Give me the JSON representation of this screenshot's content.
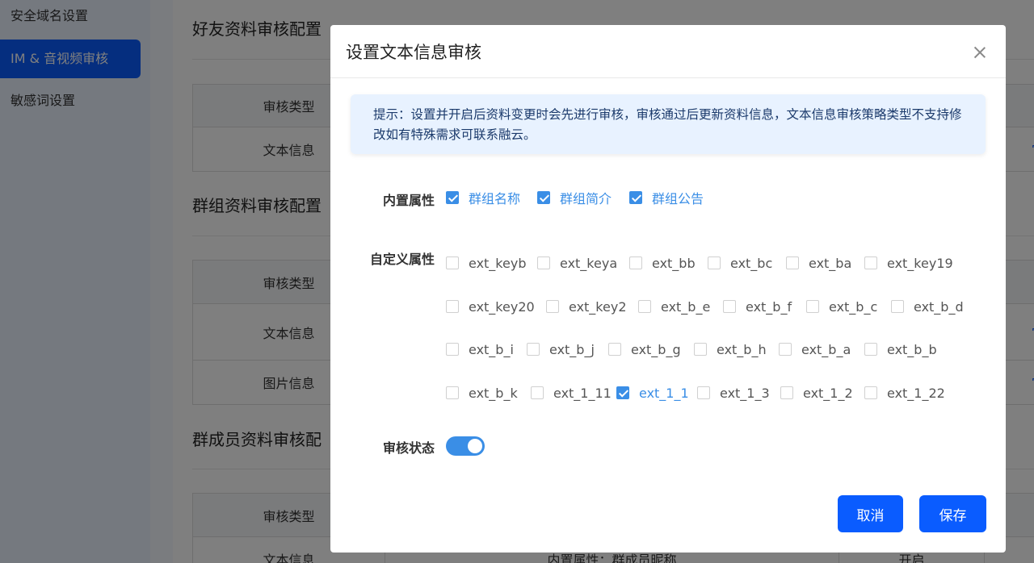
{
  "sidebar": {
    "items": [
      {
        "label": "安全域名设置"
      },
      {
        "label": "IM & 音视频审核"
      },
      {
        "label": "敏感词设置"
      }
    ]
  },
  "main": {
    "sections": [
      {
        "title": "好友资料审核配置",
        "rows": [
          [
            "审核类型"
          ],
          [
            "文本信息",
            "",
            "",
            "官"
          ]
        ]
      },
      {
        "title": "群组资料审核配置",
        "rows": [
          [
            "审核类型"
          ],
          [
            "文本信息",
            "",
            "",
            "官"
          ],
          [
            "图片信息",
            "",
            "",
            "官"
          ]
        ]
      },
      {
        "title": "群成员资料审核配",
        "rows": [
          [
            "审核类型"
          ],
          [
            "文本信息",
            "内置属性：群成员昵称",
            "开启",
            ""
          ]
        ]
      }
    ]
  },
  "modal": {
    "title": "设置文本信息审核",
    "tip": "提示：设置并开启后资料变更时会先进行审核，审核通过后更新资料信息，文本信息审核策略类型不支持修改如有特殊需求可联系融云。",
    "builtin_label": "内置属性",
    "builtin_options": [
      {
        "label": "群组名称",
        "checked": true
      },
      {
        "label": "群组简介",
        "checked": true
      },
      {
        "label": "群组公告",
        "checked": true
      }
    ],
    "custom_label": "自定义属性",
    "custom_rows": [
      [
        {
          "label": "ext_keyb",
          "checked": false
        },
        {
          "label": "ext_keya",
          "checked": false
        },
        {
          "label": "ext_bb",
          "checked": false
        },
        {
          "label": "ext_bc",
          "checked": false
        },
        {
          "label": "ext_ba",
          "checked": false
        },
        {
          "label": "ext_key19",
          "checked": false
        }
      ],
      [
        {
          "label": "ext_key20",
          "checked": false
        },
        {
          "label": "ext_key2",
          "checked": false
        },
        {
          "label": "ext_b_e",
          "checked": false
        },
        {
          "label": "ext_b_f",
          "checked": false
        },
        {
          "label": "ext_b_c",
          "checked": false
        },
        {
          "label": "ext_b_d",
          "checked": false
        }
      ],
      [
        {
          "label": "ext_b_i",
          "checked": false
        },
        {
          "label": "ext_b_j",
          "checked": false
        },
        {
          "label": "ext_b_g",
          "checked": false
        },
        {
          "label": "ext_b_h",
          "checked": false
        },
        {
          "label": "ext_b_a",
          "checked": false
        },
        {
          "label": "ext_b_b",
          "checked": false
        }
      ],
      [
        {
          "label": "ext_b_k",
          "checked": false
        },
        {
          "label": "ext_1_11",
          "checked": false
        },
        {
          "label": "ext_1_1",
          "checked": true
        },
        {
          "label": "ext_1_3",
          "checked": false
        },
        {
          "label": "ext_1_2",
          "checked": false
        },
        {
          "label": "ext_1_22",
          "checked": false
        }
      ]
    ],
    "status_label": "审核状态",
    "status_on": true,
    "cancel_label": "取消",
    "save_label": "保存"
  },
  "colors": {
    "accent": "#0a5cff",
    "checkbox_checked": "#3a8ee6",
    "tip_bg": "#e8f2ff"
  }
}
